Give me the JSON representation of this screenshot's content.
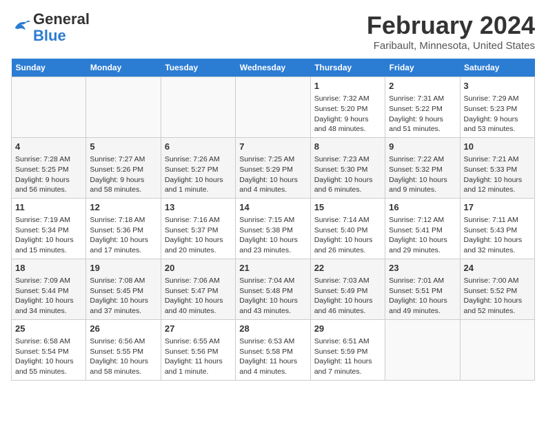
{
  "header": {
    "logo_line1": "General",
    "logo_line2": "Blue",
    "main_title": "February 2024",
    "subtitle": "Faribault, Minnesota, United States"
  },
  "days_of_week": [
    "Sunday",
    "Monday",
    "Tuesday",
    "Wednesday",
    "Thursday",
    "Friday",
    "Saturday"
  ],
  "weeks": [
    [
      {
        "day": "",
        "info": ""
      },
      {
        "day": "",
        "info": ""
      },
      {
        "day": "",
        "info": ""
      },
      {
        "day": "",
        "info": ""
      },
      {
        "day": "1",
        "info": "Sunrise: 7:32 AM\nSunset: 5:20 PM\nDaylight: 9 hours and 48 minutes."
      },
      {
        "day": "2",
        "info": "Sunrise: 7:31 AM\nSunset: 5:22 PM\nDaylight: 9 hours and 51 minutes."
      },
      {
        "day": "3",
        "info": "Sunrise: 7:29 AM\nSunset: 5:23 PM\nDaylight: 9 hours and 53 minutes."
      }
    ],
    [
      {
        "day": "4",
        "info": "Sunrise: 7:28 AM\nSunset: 5:25 PM\nDaylight: 9 hours and 56 minutes."
      },
      {
        "day": "5",
        "info": "Sunrise: 7:27 AM\nSunset: 5:26 PM\nDaylight: 9 hours and 58 minutes."
      },
      {
        "day": "6",
        "info": "Sunrise: 7:26 AM\nSunset: 5:27 PM\nDaylight: 10 hours and 1 minute."
      },
      {
        "day": "7",
        "info": "Sunrise: 7:25 AM\nSunset: 5:29 PM\nDaylight: 10 hours and 4 minutes."
      },
      {
        "day": "8",
        "info": "Sunrise: 7:23 AM\nSunset: 5:30 PM\nDaylight: 10 hours and 6 minutes."
      },
      {
        "day": "9",
        "info": "Sunrise: 7:22 AM\nSunset: 5:32 PM\nDaylight: 10 hours and 9 minutes."
      },
      {
        "day": "10",
        "info": "Sunrise: 7:21 AM\nSunset: 5:33 PM\nDaylight: 10 hours and 12 minutes."
      }
    ],
    [
      {
        "day": "11",
        "info": "Sunrise: 7:19 AM\nSunset: 5:34 PM\nDaylight: 10 hours and 15 minutes."
      },
      {
        "day": "12",
        "info": "Sunrise: 7:18 AM\nSunset: 5:36 PM\nDaylight: 10 hours and 17 minutes."
      },
      {
        "day": "13",
        "info": "Sunrise: 7:16 AM\nSunset: 5:37 PM\nDaylight: 10 hours and 20 minutes."
      },
      {
        "day": "14",
        "info": "Sunrise: 7:15 AM\nSunset: 5:38 PM\nDaylight: 10 hours and 23 minutes."
      },
      {
        "day": "15",
        "info": "Sunrise: 7:14 AM\nSunset: 5:40 PM\nDaylight: 10 hours and 26 minutes."
      },
      {
        "day": "16",
        "info": "Sunrise: 7:12 AM\nSunset: 5:41 PM\nDaylight: 10 hours and 29 minutes."
      },
      {
        "day": "17",
        "info": "Sunrise: 7:11 AM\nSunset: 5:43 PM\nDaylight: 10 hours and 32 minutes."
      }
    ],
    [
      {
        "day": "18",
        "info": "Sunrise: 7:09 AM\nSunset: 5:44 PM\nDaylight: 10 hours and 34 minutes."
      },
      {
        "day": "19",
        "info": "Sunrise: 7:08 AM\nSunset: 5:45 PM\nDaylight: 10 hours and 37 minutes."
      },
      {
        "day": "20",
        "info": "Sunrise: 7:06 AM\nSunset: 5:47 PM\nDaylight: 10 hours and 40 minutes."
      },
      {
        "day": "21",
        "info": "Sunrise: 7:04 AM\nSunset: 5:48 PM\nDaylight: 10 hours and 43 minutes."
      },
      {
        "day": "22",
        "info": "Sunrise: 7:03 AM\nSunset: 5:49 PM\nDaylight: 10 hours and 46 minutes."
      },
      {
        "day": "23",
        "info": "Sunrise: 7:01 AM\nSunset: 5:51 PM\nDaylight: 10 hours and 49 minutes."
      },
      {
        "day": "24",
        "info": "Sunrise: 7:00 AM\nSunset: 5:52 PM\nDaylight: 10 hours and 52 minutes."
      }
    ],
    [
      {
        "day": "25",
        "info": "Sunrise: 6:58 AM\nSunset: 5:54 PM\nDaylight: 10 hours and 55 minutes."
      },
      {
        "day": "26",
        "info": "Sunrise: 6:56 AM\nSunset: 5:55 PM\nDaylight: 10 hours and 58 minutes."
      },
      {
        "day": "27",
        "info": "Sunrise: 6:55 AM\nSunset: 5:56 PM\nDaylight: 11 hours and 1 minute."
      },
      {
        "day": "28",
        "info": "Sunrise: 6:53 AM\nSunset: 5:58 PM\nDaylight: 11 hours and 4 minutes."
      },
      {
        "day": "29",
        "info": "Sunrise: 6:51 AM\nSunset: 5:59 PM\nDaylight: 11 hours and 7 minutes."
      },
      {
        "day": "",
        "info": ""
      },
      {
        "day": "",
        "info": ""
      }
    ]
  ]
}
